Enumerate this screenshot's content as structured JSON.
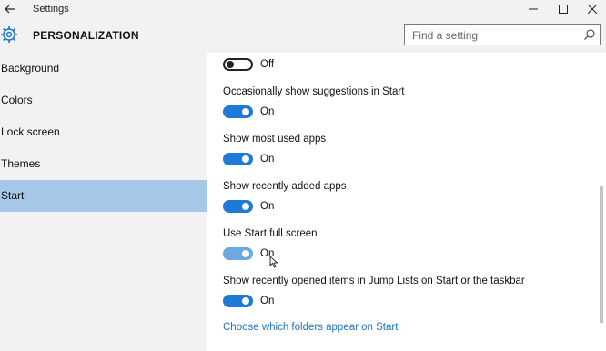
{
  "window": {
    "title": "Settings",
    "back_icon": "back-arrow-icon",
    "controls": [
      "minimize-icon",
      "maximize-icon",
      "close-icon"
    ]
  },
  "header": {
    "section_title": "PERSONALIZATION",
    "icon": "gear-icon",
    "search": {
      "placeholder": "Find a setting",
      "icon": "search-icon"
    }
  },
  "sidebar": {
    "items": [
      {
        "label": "Background",
        "selected": false
      },
      {
        "label": "Colors",
        "selected": false
      },
      {
        "label": "Lock screen",
        "selected": false
      },
      {
        "label": "Themes",
        "selected": false
      },
      {
        "label": "Start",
        "selected": true
      }
    ],
    "selected_color": "#a6c8e8"
  },
  "content": {
    "settings": [
      {
        "label": "",
        "state": "Off",
        "on": false,
        "disabled": false
      },
      {
        "label": "Occasionally show suggestions in Start",
        "state": "On",
        "on": true,
        "disabled": false
      },
      {
        "label": "Show most used apps",
        "state": "On",
        "on": true,
        "disabled": false
      },
      {
        "label": "Show recently added apps",
        "state": "On",
        "on": true,
        "disabled": false
      },
      {
        "label": "Use Start full screen",
        "state": "On",
        "on": true,
        "disabled": true
      },
      {
        "label": "Show recently opened items in Jump Lists on Start or the taskbar",
        "state": "On",
        "on": true,
        "disabled": false
      }
    ],
    "link": "Choose which folders appear on Start"
  },
  "colors": {
    "accent": "#1d7ad6",
    "link": "#1d72c7",
    "chrome": "#f2f2f2"
  }
}
